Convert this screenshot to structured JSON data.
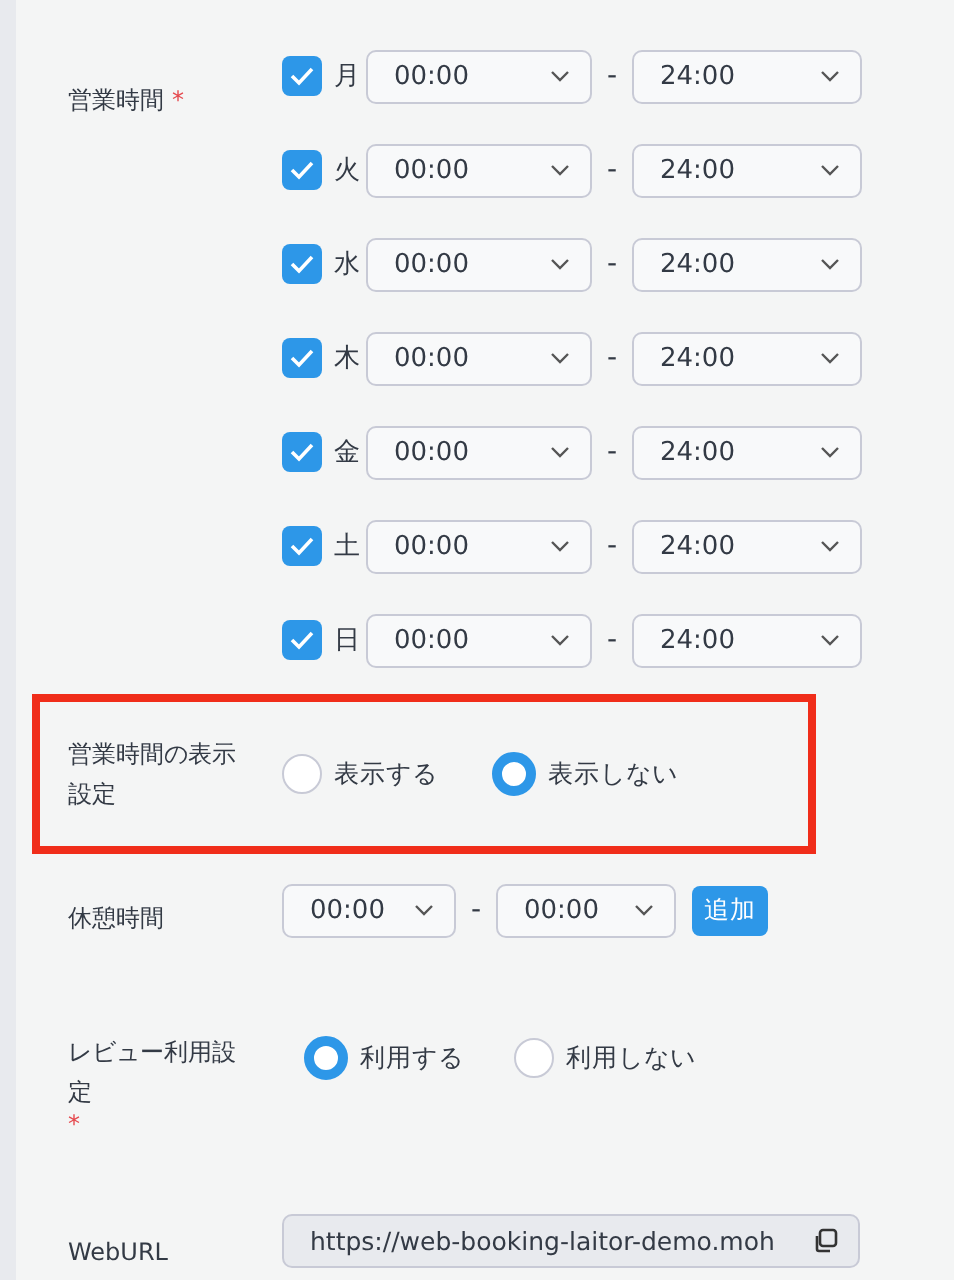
{
  "business_hours": {
    "label": "営業時間",
    "required_mark": "*",
    "days": [
      {
        "day": "月",
        "checked": true,
        "open": "00:00",
        "close": "24:00",
        "separator": "-"
      },
      {
        "day": "火",
        "checked": true,
        "open": "00:00",
        "close": "24:00",
        "separator": "-"
      },
      {
        "day": "水",
        "checked": true,
        "open": "00:00",
        "close": "24:00",
        "separator": "-"
      },
      {
        "day": "木",
        "checked": true,
        "open": "00:00",
        "close": "24:00",
        "separator": "-"
      },
      {
        "day": "金",
        "checked": true,
        "open": "00:00",
        "close": "24:00",
        "separator": "-"
      },
      {
        "day": "土",
        "checked": true,
        "open": "00:00",
        "close": "24:00",
        "separator": "-"
      },
      {
        "day": "日",
        "checked": true,
        "open": "00:00",
        "close": "24:00",
        "separator": "-"
      }
    ]
  },
  "hours_display": {
    "label": "営業時間の表示設定",
    "highlighted": true,
    "options": [
      {
        "label": "表示する",
        "selected": false
      },
      {
        "label": "表示しない",
        "selected": true
      }
    ]
  },
  "break_time": {
    "label": "休憩時間",
    "start": "00:00",
    "separator": "-",
    "end": "00:00",
    "add_button": "追加"
  },
  "review": {
    "label": "レビュー利用設定",
    "required_mark": "*",
    "options": [
      {
        "label": "利用する",
        "selected": true
      },
      {
        "label": "利用しない",
        "selected": false
      }
    ]
  },
  "web_url": {
    "label": "WebURL",
    "value": "https://web-booking-laitor-demo.moh"
  }
}
